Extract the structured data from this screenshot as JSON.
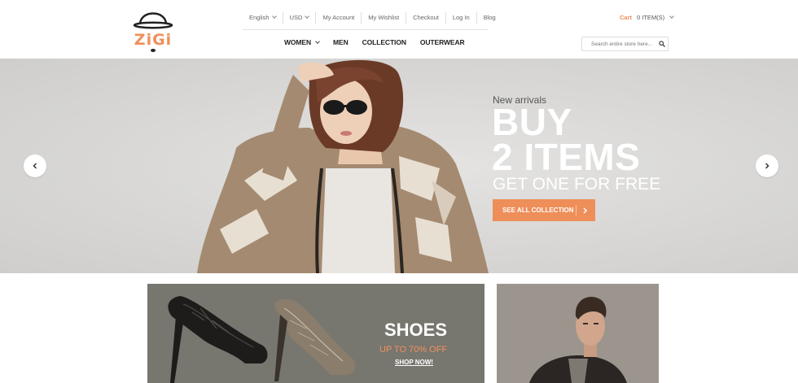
{
  "brand": {
    "logo_text": "ZiGi"
  },
  "top_links": [
    {
      "label": "English",
      "dropdown": true
    },
    {
      "label": "USD",
      "dropdown": true
    },
    {
      "label": "My Account"
    },
    {
      "label": "My Wishlist"
    },
    {
      "label": "Checkout"
    },
    {
      "label": "Log In"
    },
    {
      "label": "Blog"
    }
  ],
  "nav": {
    "women": "WOMEN",
    "men": "MEN",
    "collection": "COLLECTION",
    "outerwear": "OUTERWEAR"
  },
  "cart": {
    "label": "Cart",
    "count": "0 ITEM(S)"
  },
  "search": {
    "placeholder": "Search entire store here..."
  },
  "hero": {
    "subtitle": "New arrivals",
    "title_line1": "BUY",
    "title_line2": "2 ITEMS",
    "title_line3": "GET ONE FOR FREE",
    "button": "SEE ALL COLLECTION"
  },
  "shoes_banner": {
    "title": "SHOES",
    "subtitle": "UP TO 70% OFF",
    "link": "SHOP NOW!"
  },
  "colors": {
    "accent": "#ee8e59",
    "hero_bg": "#d9d8d6",
    "banner_bg": "#77766f"
  },
  "icons": [
    "hat-logo-icon",
    "chevron-down-icon",
    "search-icon",
    "chevron-left-icon",
    "chevron-right-icon"
  ]
}
